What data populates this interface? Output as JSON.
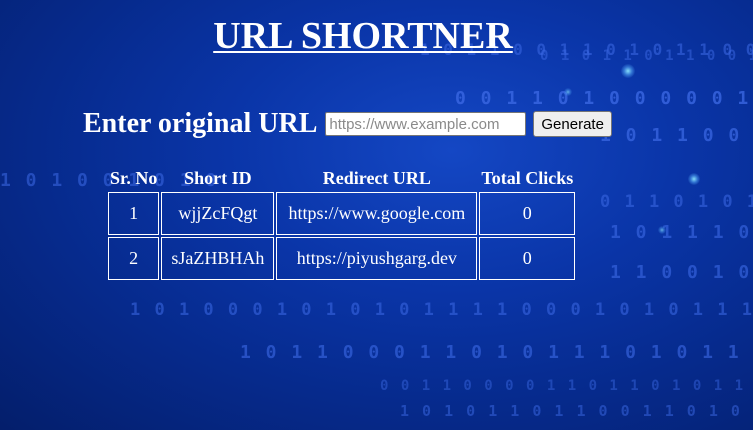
{
  "page": {
    "title": "URL SHORTNER"
  },
  "form": {
    "label": "Enter original URL",
    "input_placeholder": "https://www.example.com",
    "input_value": "",
    "button_label": "Generate"
  },
  "table": {
    "headers": {
      "sr_no": "Sr. No",
      "short_id": "Short ID",
      "redirect_url": "Redirect URL",
      "total_clicks": "Total Clicks"
    },
    "rows": [
      {
        "sr_no": "1",
        "short_id": "wjjZcFQgt",
        "redirect_url": "https://www.google.com",
        "total_clicks": "0"
      },
      {
        "sr_no": "2",
        "short_id": "sJaZHBHAh",
        "redirect_url": "https://piyushgarg.dev",
        "total_clicks": "0"
      }
    ]
  },
  "theme": {
    "background": "#0a35a8",
    "text": "#ffffff",
    "binary_digits": "#3d6ae6"
  }
}
